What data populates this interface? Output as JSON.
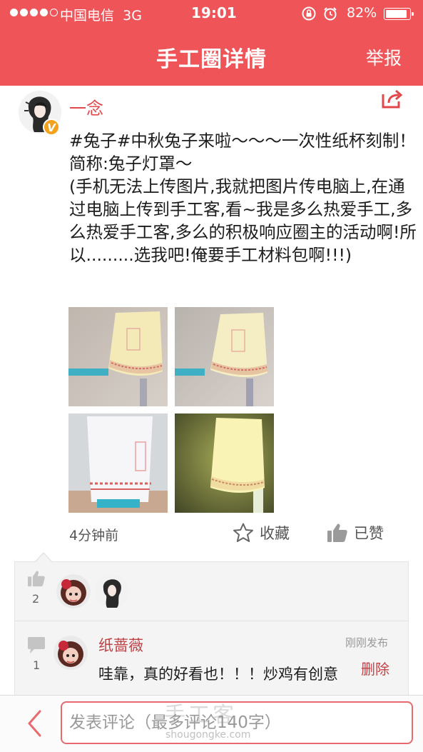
{
  "status_bar": {
    "carrier": "中国电信",
    "network": "3G",
    "time": "19:01",
    "battery": "82%"
  },
  "nav": {
    "title": "手工圈详情",
    "report_label": "举报"
  },
  "post": {
    "author": "一念",
    "verified_badge": "V",
    "body": "#兔子#中秋兔子来啦～～～一次性纸杯刻制！简称:兔子灯罩～\n(手机无法上传图片,我就把图片传电脑上,在通过电脑上传到手工客,看~我是多么热爱手工,多么热爱手工客,多么的积极响应圈主的活动啊!所以.........选我吧!俺要手工材料包啊!!!)",
    "time": "4分钟前",
    "favorite_label": "收藏",
    "liked_label": "已赞"
  },
  "likes": {
    "count": "2"
  },
  "comments": {
    "count": "1",
    "items": [
      {
        "author": "纸蔷薇",
        "time": "刚刚发布",
        "text": "哇靠，真的好看也！！！炒鸡有创意",
        "delete_label": "删除"
      }
    ]
  },
  "bottom_bar": {
    "placeholder": "发表评论（最多评论140字）"
  },
  "watermark": {
    "text": "手工客",
    "url": "shougongke.com"
  },
  "colors": {
    "brand_red": "#ee5458",
    "name_red": "#e0484c",
    "badge_orange": "#f4a21d"
  },
  "icons": [
    "share-icon",
    "star-icon",
    "thumbs-up-icon",
    "comment-icon",
    "back-chevron-icon",
    "alarm-icon",
    "rotation-lock-icon"
  ]
}
